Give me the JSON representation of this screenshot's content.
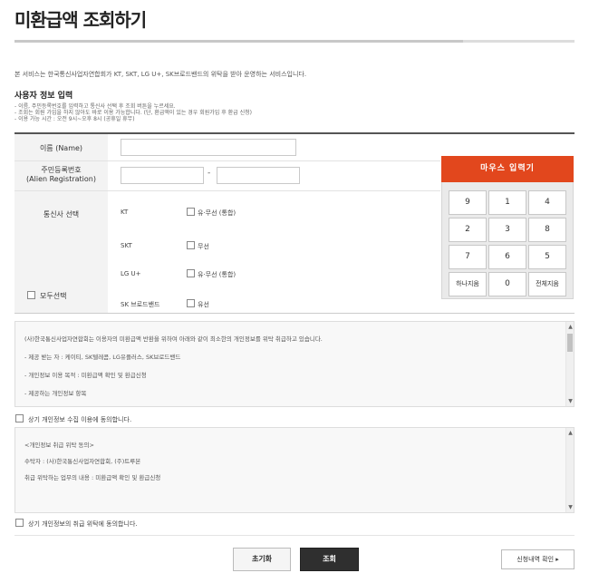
{
  "title": "미환급액 조회하기",
  "intro": "본 서비스는 한국통신사업자연합회가 KT, SKT, LG U+, SK브로드밴드의 위탁을 받아 운영하는 서비스입니다.",
  "section_title": "사용자 정보 입력",
  "notes": [
    "- 이름, 주민등록번호를 입력하고 통신사 선택 후 조회 버튼을 누르세요.",
    "- 조회는 회원 가입을 하지 않아도 바로 이용 가능합니다. (단, 환급액이 있는 경우 회원가입 후 환급 신청)",
    "- 이용 가능 시간 : 오전 9시~오후 8시 (공휴일 휴무)"
  ],
  "form": {
    "name_label": "이름 (Name)",
    "name_value": "",
    "id_label_1": "주민등록번호",
    "id_label_2": "(Alien Registration)",
    "id_front_value": "",
    "id_back_value": "",
    "id_dash": "-",
    "carrier_label": "통신사 선택",
    "select_all_label": "모두선택",
    "carriers": [
      {
        "name": "KT",
        "option": "유·무선 (통합)"
      },
      {
        "name": "SKT",
        "option": "무선"
      },
      {
        "name": "LG U+",
        "option": "유·무선 (통합)"
      },
      {
        "name": "SK 브로드밴드",
        "option": "유선"
      }
    ]
  },
  "keypad": {
    "title": "마우스 입력기",
    "keys": [
      "9",
      "1",
      "4",
      "2",
      "3",
      "8",
      "7",
      "6",
      "5",
      "하나지움",
      "0",
      "전체지움"
    ]
  },
  "terms1": {
    "lines": [
      "(사)한국통신사업자연합회는 이용자의 미환급액 반환을 위하여 아래와 같이 최소한의 개인정보를 위탁 취급하고 있습니다.",
      "- 제공 받는 자 : 케이티, SK텔레콤, LG유플러스, SK브로드밴드",
      "- 개인정보 이용 목적 : 미환급액 확인 및 환급신청",
      "- 제공하는 개인정보 항목"
    ],
    "agree_label": "상기 개인정보 수집 이용에 동의합니다."
  },
  "terms2": {
    "lines": [
      "<개인정보 취급 위탁 동의>",
      "수탁자 : (사)한국통신사업자연합회, (주)트루본",
      "취급 위탁하는 업무의 내용 : 미환급액 확인 및 환급신청"
    ],
    "agree_label": "상기 개인정보의 취급 위탁에 동의합니다."
  },
  "buttons": {
    "reset": "초기화",
    "search": "조회",
    "history": "신청내역 확인 ▸"
  }
}
